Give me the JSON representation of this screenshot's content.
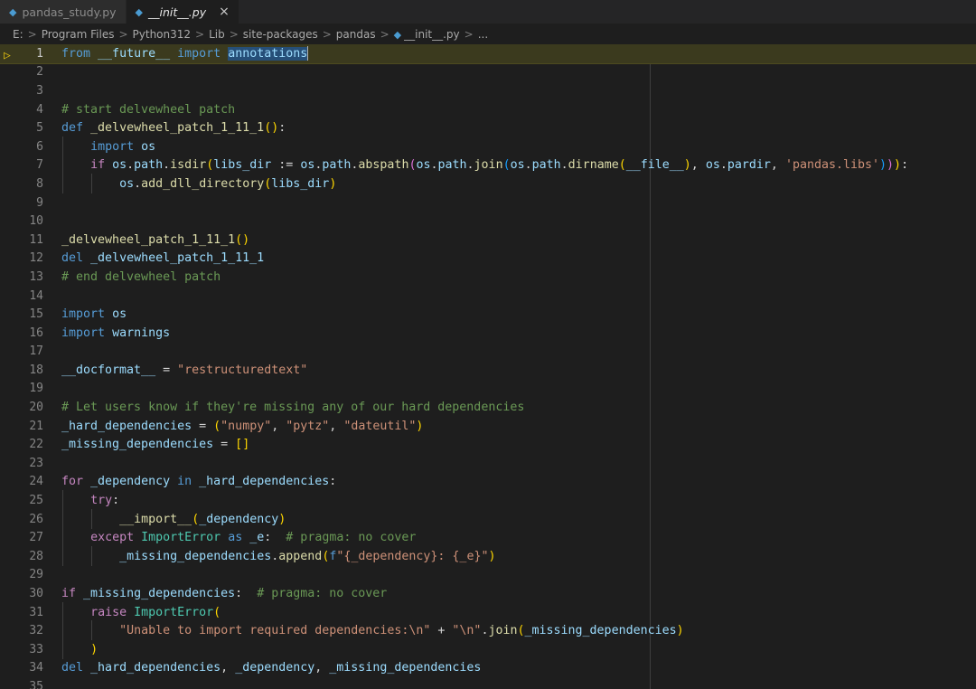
{
  "tabs": [
    {
      "label": "pandas_study.py",
      "icon": "python-file-icon",
      "active": false
    },
    {
      "label": "__init__.py",
      "icon": "python-file-icon",
      "active": true,
      "close": "×"
    }
  ],
  "breadcrumb": {
    "items": [
      "E:",
      "Program Files",
      "Python312",
      "Lib",
      "site-packages",
      "pandas",
      "__init__.py",
      "..."
    ],
    "separator": ">"
  },
  "editor": {
    "current_line": 1,
    "breakpoint_icon": "debug-breakpoint-icon",
    "lines": [
      "from __future__ import annotations",
      "",
      "",
      "# start delvewheel patch",
      "def _delvewheel_patch_1_11_1():",
      "    import os",
      "    if os.path.isdir(libs_dir := os.path.abspath(os.path.join(os.path.dirname(__file__), os.pardir, 'pandas.libs'))):",
      "        os.add_dll_directory(libs_dir)",
      "",
      "",
      "_delvewheel_patch_1_11_1()",
      "del _delvewheel_patch_1_11_1",
      "# end delvewheel patch",
      "",
      "import os",
      "import warnings",
      "",
      "__docformat__ = \"restructuredtext\"",
      "",
      "# Let users know if they're missing any of our hard dependencies",
      "_hard_dependencies = (\"numpy\", \"pytz\", \"dateutil\")",
      "_missing_dependencies = []",
      "",
      "for _dependency in _hard_dependencies:",
      "    try:",
      "        __import__(_dependency)",
      "    except ImportError as _e:  # pragma: no cover",
      "        _missing_dependencies.append(f\"{_dependency}: {_e}\")",
      "",
      "if _missing_dependencies:  # pragma: no cover",
      "    raise ImportError(",
      "        \"Unable to import required dependencies:\\n\" + \"\\n\".join(_missing_dependencies)",
      "    )",
      "del _hard_dependencies, _dependency, _missing_dependencies",
      ""
    ]
  }
}
